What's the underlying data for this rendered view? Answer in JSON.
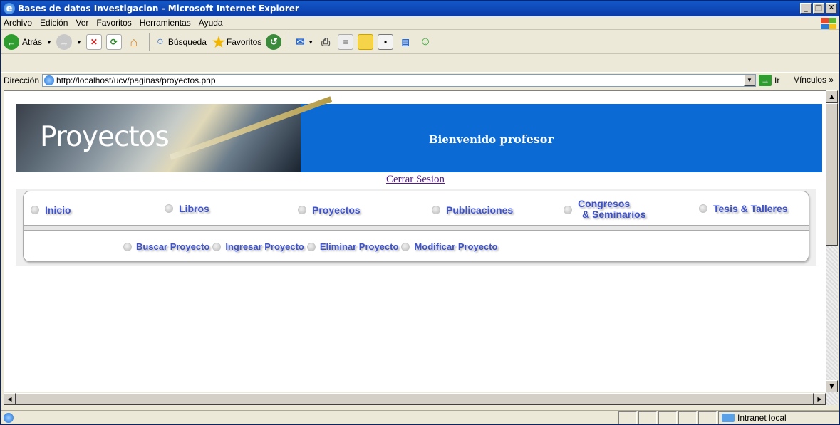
{
  "window": {
    "title": "Bases de datos Investigacion - Microsoft Internet Explorer",
    "min": "_",
    "max": "□",
    "close": "✕"
  },
  "menu": [
    "Archivo",
    "Edición",
    "Ver",
    "Favoritos",
    "Herramientas",
    "Ayuda"
  ],
  "toolbar": {
    "back": "Atrás",
    "search": "Búsqueda",
    "favorites": "Favoritos"
  },
  "address": {
    "label": "Dirección",
    "url": "http://localhost/ucv/paginas/proyectos.php",
    "go": "Ir",
    "links": "Vínculos"
  },
  "banner": {
    "title": "Proyectos",
    "welcome": "Bienvenido",
    "user": "profesor"
  },
  "logout": "Cerrar Sesion",
  "nav": [
    "Inicio",
    "Libros",
    "Proyectos",
    "Publicaciones",
    "Congresos",
    "& Seminarios",
    "Tesis & Talleres"
  ],
  "subnav": [
    "Buscar Proyecto",
    "Ingresar Proyecto",
    "Eliminar Proyecto",
    "Modificar Proyecto"
  ],
  "status": {
    "zone": "Intranet local"
  }
}
